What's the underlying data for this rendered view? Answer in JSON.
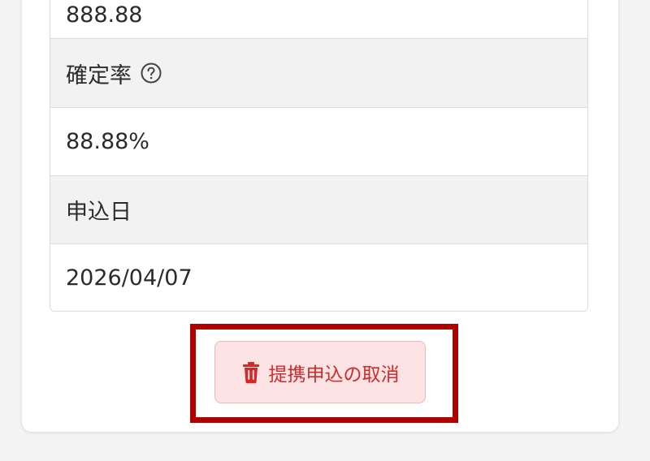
{
  "rows": [
    {
      "value": "888.88"
    },
    {
      "label": "確定率"
    },
    {
      "value": "88.88%"
    },
    {
      "label": "申込日"
    },
    {
      "value": "2026/04/07"
    }
  ],
  "icons": {
    "help": "question-circle-icon",
    "cancel": "trash-icon"
  },
  "cancel_button": {
    "label": "提携申込の取消"
  },
  "colors": {
    "danger_text": "#d22a2a",
    "danger_bg": "#fde3e3",
    "highlight": "#b00000",
    "label_bg": "#f2f2f2"
  }
}
